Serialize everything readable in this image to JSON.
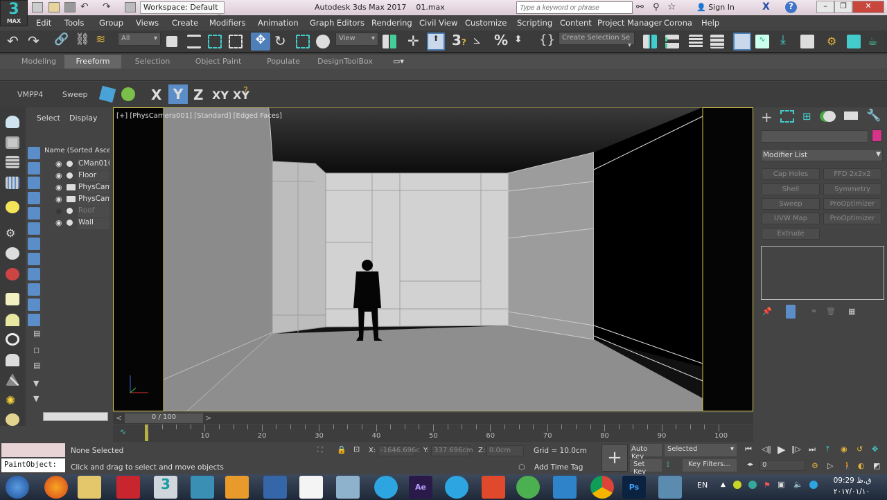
{
  "titlebar": {
    "logo": "3",
    "logo_sub": "MAX",
    "workspace": "Workspace: Default",
    "title": "Autodesk 3ds Max 2017",
    "file": "01.max",
    "search_placeholder": "Type a keyword or phrase",
    "sign_in": "Sign In"
  },
  "menu": [
    "Edit",
    "Tools",
    "Group",
    "Views",
    "Create",
    "Modifiers",
    "Animation",
    "Graph Editors",
    "Rendering",
    "Civil View",
    "Customize",
    "Scripting",
    "Content",
    "Project Manager",
    "Corona",
    "Help"
  ],
  "toolbar": {
    "selection_filter": "All",
    "ref_coord": "View",
    "named_selection": "Create Selection Se",
    "snap_label": "3",
    "percent": "%"
  },
  "ribbon": {
    "tabs": [
      "Modeling",
      "Freeform",
      "Selection",
      "Object Paint",
      "Populate",
      "DesignToolBox"
    ],
    "active": "Freeform"
  },
  "toolbar2": {
    "buttons": [
      "VMPP4",
      "Sweep"
    ],
    "axes": [
      "X",
      "Y",
      "Z",
      "XY",
      "XY"
    ],
    "active_axis": "Y"
  },
  "explorer": {
    "tabs": [
      "Select",
      "Display"
    ],
    "header": "Name (Sorted Ascer",
    "items": [
      {
        "name": "CMan010",
        "type": "object",
        "visible": true
      },
      {
        "name": "Floor",
        "type": "object",
        "visible": true
      },
      {
        "name": "PhysCam",
        "type": "camera",
        "visible": true
      },
      {
        "name": "PhysCam",
        "type": "camera",
        "visible": true
      },
      {
        "name": "Roof",
        "type": "object",
        "visible": false
      },
      {
        "name": "Wall",
        "type": "object",
        "visible": true
      }
    ]
  },
  "viewport": {
    "label": "[+] [PhysCamera001] [Standard] [Edged Faces]"
  },
  "command_panel": {
    "modifier_list": "Modifier List",
    "color_swatch": "#d6338a",
    "modifiers": [
      "Cap Holes",
      "FFD 2x2x2",
      "Shell",
      "Symmetry",
      "Sweep",
      "ProOptimizer",
      "UVW Map",
      "ProOptimizer",
      "Extrude"
    ]
  },
  "timeline": {
    "slider": "0 / 100",
    "ticks": [
      "0",
      "10",
      "20",
      "30",
      "40",
      "50",
      "60",
      "70",
      "80",
      "90",
      "100"
    ],
    "current_frame": 0
  },
  "status": {
    "maxscript": "PaintObject:",
    "selection": "None Selected",
    "prompt": "Click and drag to select and move objects",
    "x_label": "X:",
    "x": "-1646.696c",
    "y_label": "Y:",
    "y": "337.696cm",
    "z_label": "Z:",
    "z": "0.0cm",
    "grid": "Grid = 10.0cm",
    "add_time_tag": "Add Time Tag",
    "auto_key": "Auto Key",
    "set_key": "Set Key",
    "key_mode": "Selected",
    "key_filters": "Key Filters...",
    "frame": "0"
  },
  "taskbar": {
    "lang": "EN",
    "time": "09:29 ق.ظ",
    "date": "۲۰۱۷/۰۱/۱۰"
  }
}
